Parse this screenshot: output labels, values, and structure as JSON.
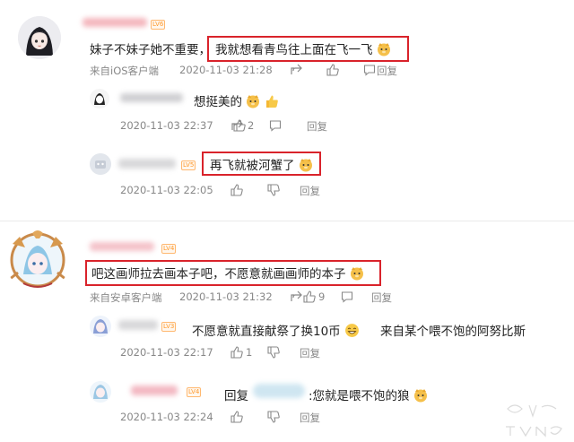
{
  "comments": [
    {
      "text": "妹子不妹子她不重要，",
      "highlight": "我就想看青鸟往上面在飞一飞",
      "source": "来自iOS客户端",
      "time": "2020-11-03 21:28",
      "reply_label": "回复",
      "replies": [
        {
          "text": "想挺美的",
          "time": "2020-11-03 22:37",
          "likes": "2",
          "reply_label": "回复"
        },
        {
          "text": "再飞就被河蟹了",
          "time": "2020-11-03 22:05",
          "reply_label": "回复"
        }
      ]
    },
    {
      "text": "吧这画师拉去画本子吧，不愿意就画画师的本子",
      "source": "来自安卓客户端",
      "time": "2020-11-03 21:32",
      "likes": "9",
      "reply_label": "回复",
      "replies": [
        {
          "text": "不愿意就直接献祭了换10币",
          "tail": "来自某个喂不饱的阿努比斯",
          "time": "2020-11-03 22:17",
          "likes": "1",
          "reply_label": "回复"
        },
        {
          "prefix": "回复",
          "text": ":您就是喂不饱的狼",
          "time": "2020-11-03 22:24",
          "reply_label": "回复"
        }
      ]
    }
  ],
  "colors": {
    "highlight_box": "#d9232b",
    "meta_text": "#888888",
    "level_badge": "#ff9a2e"
  }
}
